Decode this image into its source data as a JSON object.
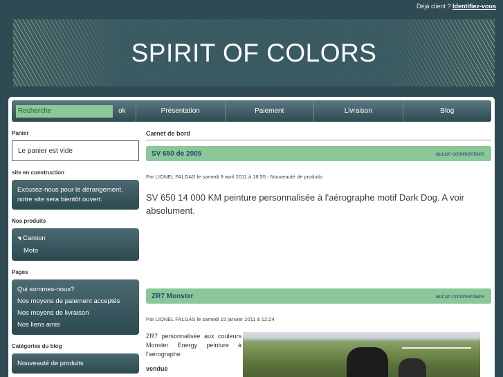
{
  "topbar": {
    "text": "Déjà client ?",
    "link": "Identifiez-vous"
  },
  "banner": {
    "title": "SPIRIT OF COLORS"
  },
  "nav": {
    "search_placeholder": "Recherche",
    "ok_label": "ok",
    "items": [
      "Présentation",
      "Paiement",
      "Livraison",
      "Blog"
    ]
  },
  "sidebar": {
    "cart": {
      "title": "Panier",
      "text": "Le panier est vide"
    },
    "construction": {
      "title": "site en construction",
      "lines": [
        "Excusez-nous pour le dérangement,",
        "notre site sera bientôt ouvert."
      ]
    },
    "products": {
      "title": "Nos produits",
      "items": [
        "Camion",
        "Moto"
      ]
    },
    "pages": {
      "title": "Pages",
      "items": [
        "Qui sommes-nous?",
        "Nos moyens de paiement acceptés",
        "Nos moyens de livraison",
        "Nos liens amis"
      ]
    },
    "blog_categories": {
      "title": "Catégories du blog",
      "items": [
        "Nouveauté de produits"
      ]
    }
  },
  "content": {
    "section_title": "Carnet de bord",
    "posts": [
      {
        "title": "SV 650 de 2005",
        "comments": "aucun commentaire",
        "meta": "Par LIONEL FALGAS le samedi 9 avril 2011 à 18:55 - Nouveauté de produits",
        "body": "SV 650 14 000 KM peinture personnalisée à l'aérographe motif Dark Dog. A voir absolument."
      },
      {
        "title": "ZR7 Monster",
        "comments": "aucun commentaire",
        "meta": "Par LIONEL FALGAS le samedi 15 janvier 2011 à 12:24",
        "body": "ZR7 personnalisée aux couleurs Monster Energy peinture à l'aérographe",
        "status": "vendue"
      }
    ]
  },
  "colors": {
    "background": "#2f4a52",
    "accent_green": "#8cc79a",
    "link_blue": "#1e4f66"
  }
}
